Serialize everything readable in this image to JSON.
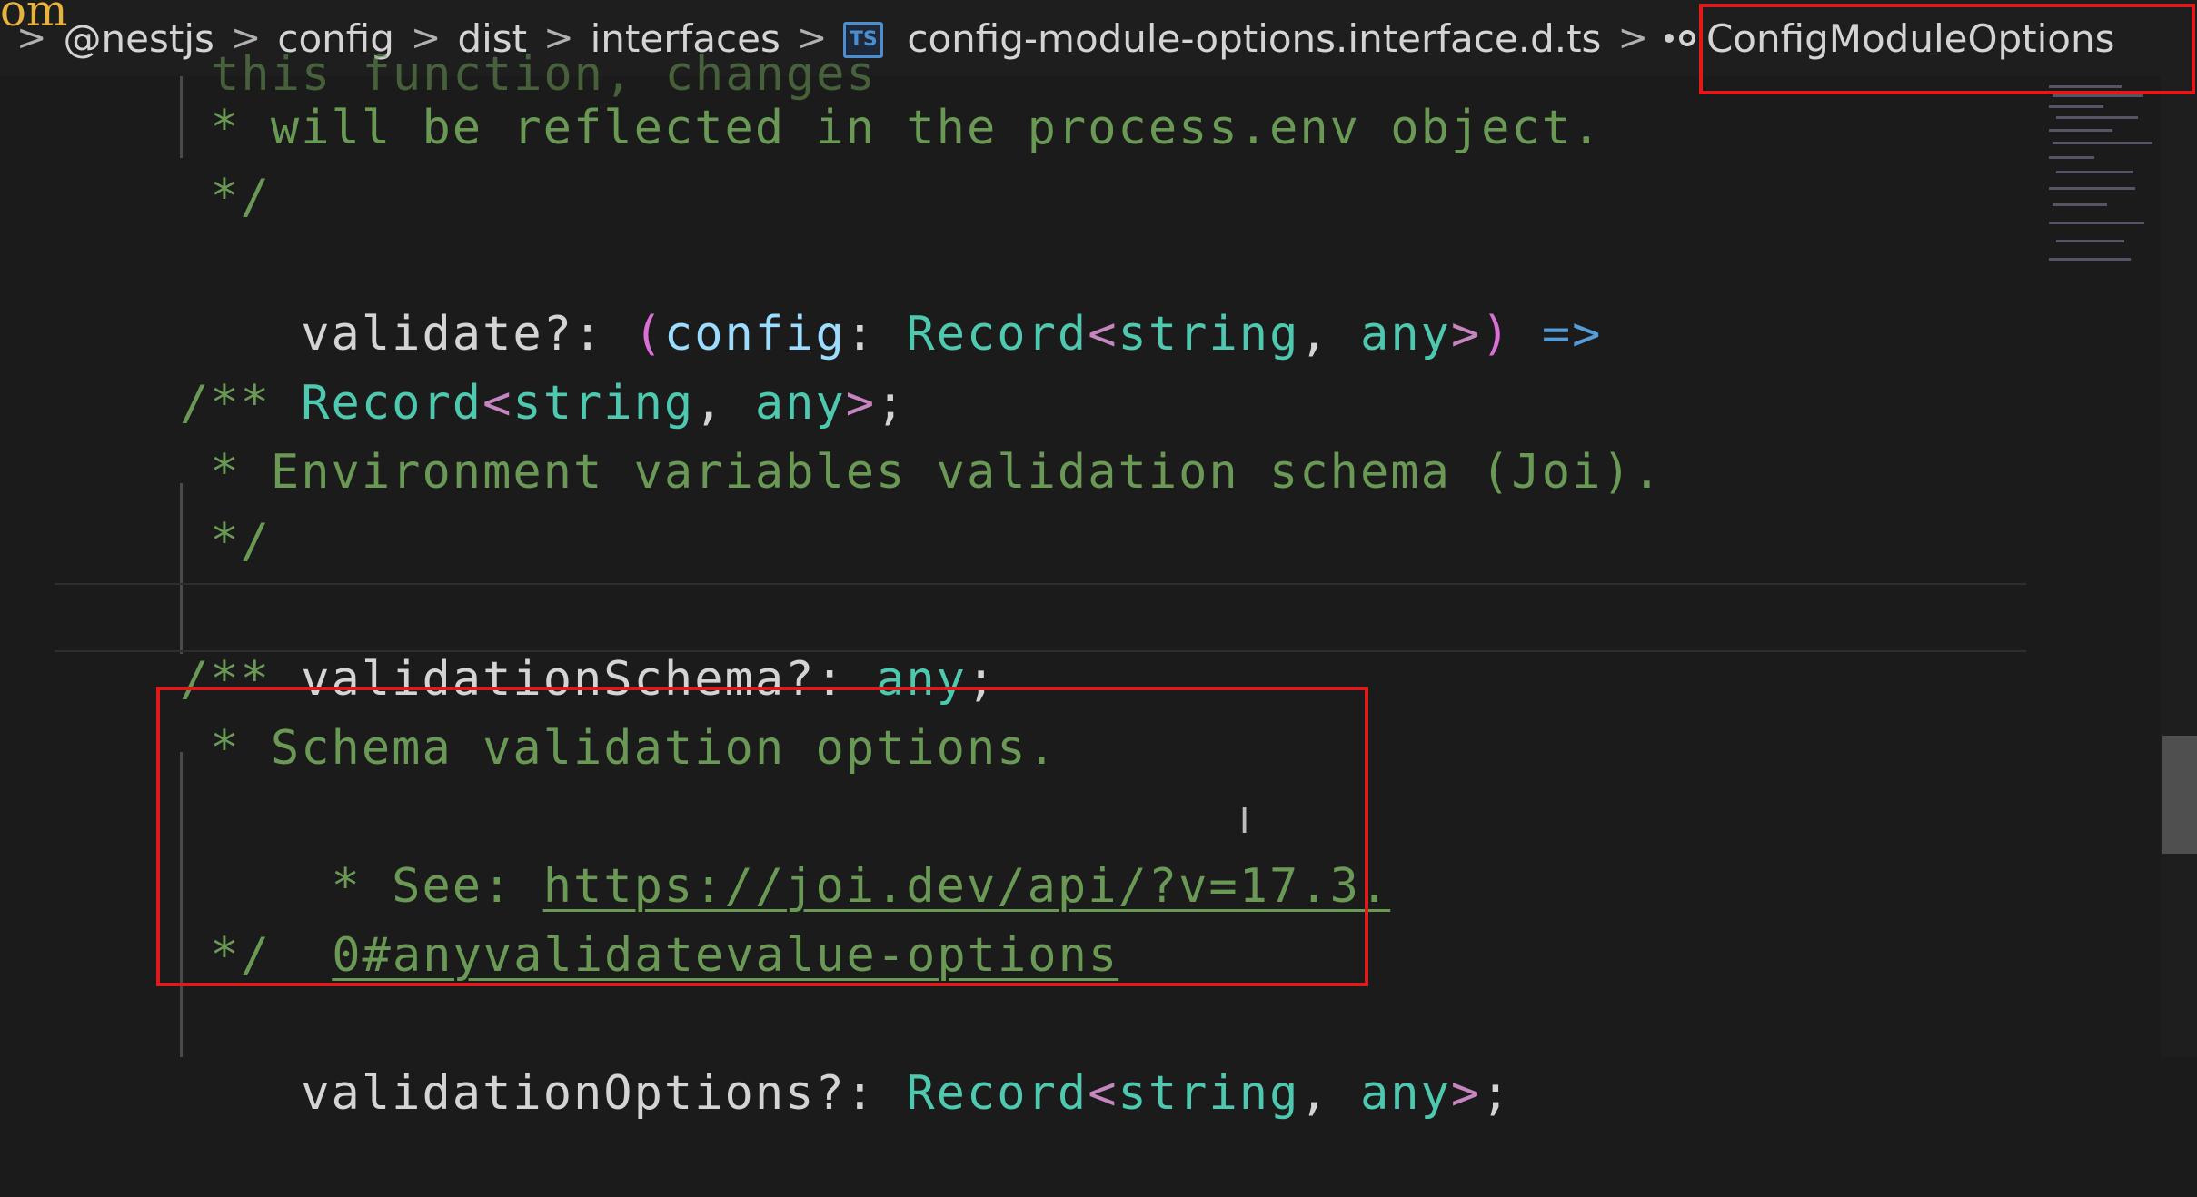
{
  "breadcrumb": {
    "overlay_text": "om",
    "items": [
      "@nestjs",
      "config",
      "dist",
      "interfaces",
      "config-module-options.interface.d.ts",
      "ConfigModuleOptions"
    ],
    "file_icon_label": "TS"
  },
  "code": {
    "line0": "this function, changes",
    "line1_comment": " * will be reflected in the process.env object.",
    "line2_comment": " */",
    "line3": {
      "prop": "validate?: ",
      "open_paren": "(",
      "param": "config",
      "colon": ": ",
      "type": "Record",
      "lt": "<",
      "kw1": "string",
      "comma": ", ",
      "kw2": "any",
      "gt": ">",
      "close_paren": ")",
      "arrow": " =>"
    },
    "line4": {
      "type": "Record",
      "lt": "<",
      "kw1": "string",
      "comma": ", ",
      "kw2": "any",
      "gt": ">",
      "semi": ";"
    },
    "line5_comment": "/**",
    "line6_comment": " * Environment variables validation schema (Joi).",
    "line7_comment": " */",
    "line8": {
      "prop": "validationSchema?: ",
      "kw": "any",
      "semi": ";"
    },
    "line9_comment": "/**",
    "line10_comment": " * Schema validation options.",
    "line11_prefix": " * See: ",
    "line11_link": "https://joi.dev/api/?v=17.3.",
    "line12_link": "0#anyvalidatevalue-options",
    "line13_comment": " */",
    "line14": {
      "prop": "validationOptions?: ",
      "type": "Record",
      "lt": "<",
      "kw1": "string",
      "comma": ", ",
      "kw2": "any",
      "gt": ">",
      "semi": ";"
    }
  },
  "colors": {
    "comment": "#6a9955",
    "type": "#4ec9b0",
    "param": "#9cdcfe",
    "bracket": "#c586c0",
    "highlight_box": "#e01a1a"
  }
}
